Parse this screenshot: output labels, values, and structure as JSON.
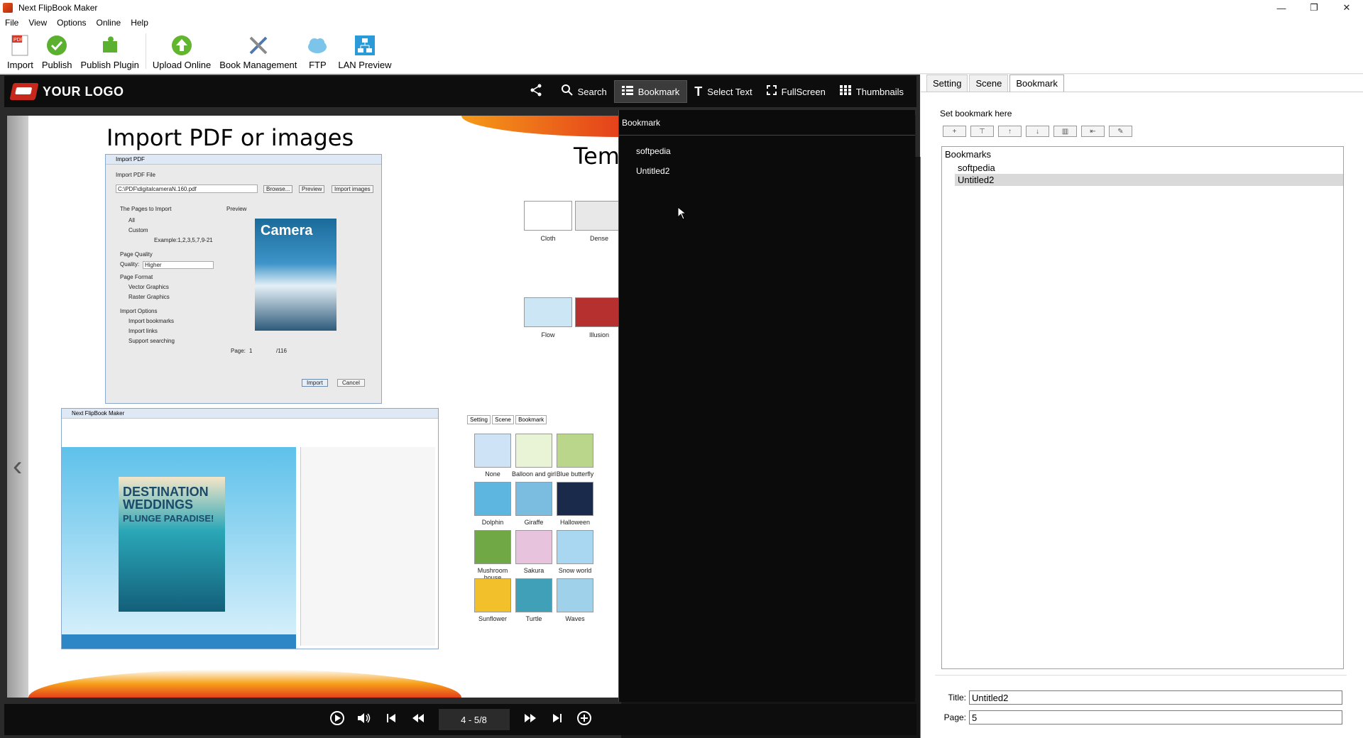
{
  "window": {
    "title": "Next FlipBook Maker",
    "minimize": "—",
    "maximize": "❐",
    "close": "✕"
  },
  "menu": [
    "File",
    "View",
    "Options",
    "Online",
    "Help"
  ],
  "toolbar": {
    "import": "Import",
    "publish": "Publish",
    "publish_plugin": "Publish Plugin",
    "upload_online": "Upload Online",
    "book_management": "Book Management",
    "ftp": "FTP",
    "lan_preview": "LAN Preview"
  },
  "viewer": {
    "logo_text": "YOUR LOGO",
    "share": "",
    "search": "Search",
    "bookmark": "Bookmark",
    "select_text": "Select Text",
    "fullscreen": "FullScreen",
    "thumbnails": "Thumbnails",
    "left_page_heading": "Import PDF or images",
    "right_page_heading": "Template and scene",
    "page_indicator": "4 - 5/8"
  },
  "left_page": {
    "dialog_title": "Import PDF",
    "import_pdf_file": "Import PDF File",
    "file_path": "C:\\PDF\\digitalcameraN.160.pdf",
    "browse": "Browse...",
    "preview_btn": "Preview",
    "import_images": "Import images",
    "pages_to_import": "The Pages to Import",
    "preview": "Preview",
    "all": "All",
    "custom": "Custom",
    "example": "Example:1,2,3,5,7,9-21",
    "page_quality": "Page Quality",
    "quality": "Quality:",
    "quality_val": "Higher",
    "page_format": "Page Format",
    "vector": "Vector Graphics",
    "raster": "Raster Graphics",
    "import_options": "Import Options",
    "import_bookmarks": "Import bookmarks",
    "import_links": "Import links",
    "support_searching": "Support searching",
    "page_lbl": "Page:",
    "page_val": "1",
    "page_total": "/116",
    "import_btn": "Import",
    "cancel_btn": "Cancel",
    "magazine_title": "Camera",
    "inner_app": "Next FlipBook Maker",
    "travel_title": "DESTINATION WEDDINGS",
    "travel_sub": "PLUNGE PARADISE!"
  },
  "right_page": {
    "thumbs": [
      "Cloth",
      "Dense",
      "Flow",
      "Illusion"
    ],
    "scene_tabs": [
      "Setting",
      "Scene",
      "Bookmark"
    ],
    "scenes": [
      "None",
      "Balloon and girl",
      "Blue butterfly",
      "Dolphin",
      "Giraffe",
      "Halloween",
      "Mushroom house",
      "Sakura",
      "Snow world",
      "Sunflower",
      "Turtle",
      "Waves"
    ]
  },
  "bookmark_overlay": {
    "header": "Bookmark",
    "items": [
      "softpedia",
      "Untitled2"
    ]
  },
  "panel": {
    "tabs": [
      "Setting",
      "Scene",
      "Bookmark"
    ],
    "set_label": "Set bookmark here",
    "tools": [
      "+",
      "⊤",
      "↑",
      "↓",
      "▥",
      "⇤",
      "✎"
    ],
    "tree_root": "Bookmarks",
    "tree_items": [
      "softpedia",
      "Untitled2"
    ],
    "title_label": "Title:",
    "title_value": "Untitled2",
    "page_label": "Page:",
    "page_value": "5"
  },
  "colors": {
    "accent_orange": "#f59a18",
    "logo_red": "#c8281c",
    "viewer_bg": "#0d0d0d"
  }
}
